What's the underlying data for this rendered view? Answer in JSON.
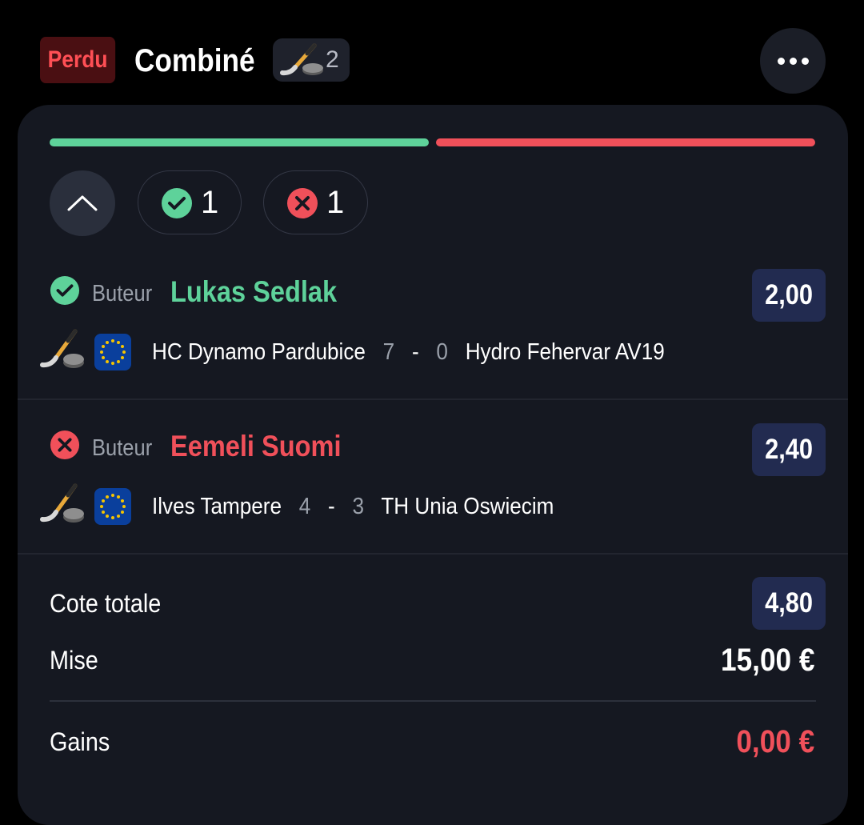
{
  "header": {
    "status": "Perdu",
    "title": "Combiné",
    "sport_icon": "ice-hockey-icon",
    "sport_count": "2",
    "more_icon": "more-horizontal-icon"
  },
  "progress": {
    "won_fraction": 0.5,
    "lost_fraction": 0.5,
    "won_color": "#5ed29a",
    "lost_color": "#f0505a"
  },
  "filters": {
    "collapse_icon": "chevron-up-icon",
    "won_count": "1",
    "lost_count": "1"
  },
  "selections": [
    {
      "result": "won",
      "market": "Buteur",
      "player": "Lukas Sedlak",
      "odds": "2,00",
      "competition_icon": "eu-flag-icon",
      "home_team": "HC Dynamo Pardubice",
      "home_score": "7",
      "separator": "-",
      "away_score": "0",
      "away_team": "Hydro Fehervar AV19"
    },
    {
      "result": "lost",
      "market": "Buteur",
      "player": "Eemeli Suomi",
      "odds": "2,40",
      "competition_icon": "eu-flag-icon",
      "home_team": "Ilves Tampere",
      "home_score": "4",
      "separator": "-",
      "away_score": "3",
      "away_team": "TH Unia Oswiecim"
    }
  ],
  "summary": {
    "total_odds_label": "Cote totale",
    "total_odds": "4,80",
    "stake_label": "Mise",
    "stake": "15,00 €",
    "winnings_label": "Gains",
    "winnings": "0,00 €"
  },
  "colors": {
    "background": "#000000",
    "card": "#151821",
    "win": "#5ed29a",
    "loss": "#f0505a",
    "odds_badge": "#222b50"
  }
}
